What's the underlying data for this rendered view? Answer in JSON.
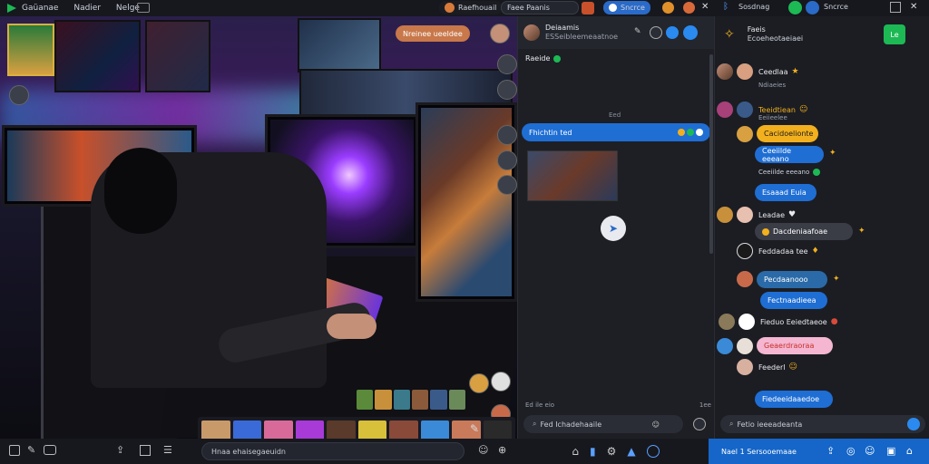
{
  "topbar": {
    "menu": [
      "Gaüanae",
      "Nadier",
      "Nelge"
    ],
    "broadcast_label": "Raefhouail",
    "tab_label": "Faee Paanis",
    "right_tab_label": "Sosdnag",
    "center_tab_label": "Sncrce"
  },
  "stage": {
    "tag_label": "Nreinee ueeldee"
  },
  "bottombar": {
    "search_placeholder": "Hnaa ehaisegaeuidn"
  },
  "mid": {
    "header_title": "Deiaamis",
    "header_sub": "ESSeibleemeaatnoe",
    "user_label": "Raeide",
    "time1": "Eed",
    "bubble1": "Fhichtin ted",
    "status": "Ed ile eio",
    "time2": "1ee",
    "input_placeholder": "Fed Ichadehaaile"
  },
  "right": {
    "header_title": "Faeis",
    "header_sub": "Ecoeheotaeiaei",
    "messages": [
      {
        "name": "Ceedlaa",
        "sub": "Ndiaeies"
      },
      {
        "name": "Teeidtiean",
        "sub": "Eeiieelee"
      },
      {
        "bubble": "Cacidoelionte"
      },
      {
        "bubble": "Ceeiilde eeeano"
      },
      {
        "bubble": "Esaaad Euia"
      },
      {
        "name": "Leadae"
      },
      {
        "bubble": "Dacdeniaafoae"
      },
      {
        "name": "Feddadaa tee"
      },
      {
        "bubble": "Pecdaanooo"
      },
      {
        "bubble": "Fectnaadieea"
      },
      {
        "name": "Fieduo Eeiedtaeoe"
      },
      {
        "bubble": "Geaerdraoraa"
      },
      {
        "name": "Feederl"
      },
      {
        "bubble": "Fiedeeidaaedoe"
      }
    ],
    "input_placeholder": "Fetio ieeeadeanta",
    "footer_label": "Nael 1 Sersooemaae"
  },
  "colors": {
    "accent_blue": "#2a8af0",
    "green": "#1db954",
    "orange": "#d87a3a",
    "yellow": "#f2b01e",
    "pink": "#f4b6d0"
  }
}
